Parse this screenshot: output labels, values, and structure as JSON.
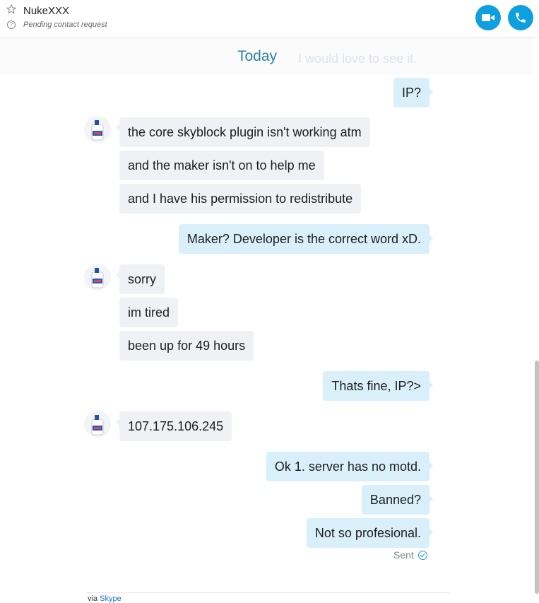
{
  "header": {
    "contact_name": "NukeXXX",
    "contact_status": "Pending contact request",
    "accent": "#0e9fdf",
    "icons": [
      "star-icon",
      "help-circle-icon",
      "video-icon",
      "phone-icon"
    ]
  },
  "date_divider": {
    "label": "Today",
    "ghost_text": "I would love to see it."
  },
  "messages": [
    {
      "direction": "out",
      "text": "IP?"
    },
    {
      "direction": "in",
      "text": "the core skyblock plugin isn't working atm"
    },
    {
      "direction": "in",
      "text": "and the maker isn't on to help me"
    },
    {
      "direction": "in",
      "text": "and I have his permission to redistribute"
    },
    {
      "direction": "out",
      "text": "Maker? Developer is the correct word xD."
    },
    {
      "direction": "in",
      "text": "sorry"
    },
    {
      "direction": "in",
      "text": "im tired"
    },
    {
      "direction": "in",
      "text": "been up for 49 hours"
    },
    {
      "direction": "out",
      "text": "Thats fine, IP?>"
    },
    {
      "direction": "in",
      "text": "107.175.106.245"
    },
    {
      "direction": "out",
      "text": "Ok 1. server has no motd."
    },
    {
      "direction": "out",
      "text": "Banned?"
    },
    {
      "direction": "out",
      "text": "Not so profesional."
    }
  ],
  "sent_status": "Sent",
  "footer": {
    "prefix": "via",
    "link": "Skype"
  },
  "colors": {
    "incoming_bubble": "#eff1f4",
    "outgoing_bubble": "#d9f0fb",
    "date_text": "#2a7fb5"
  }
}
